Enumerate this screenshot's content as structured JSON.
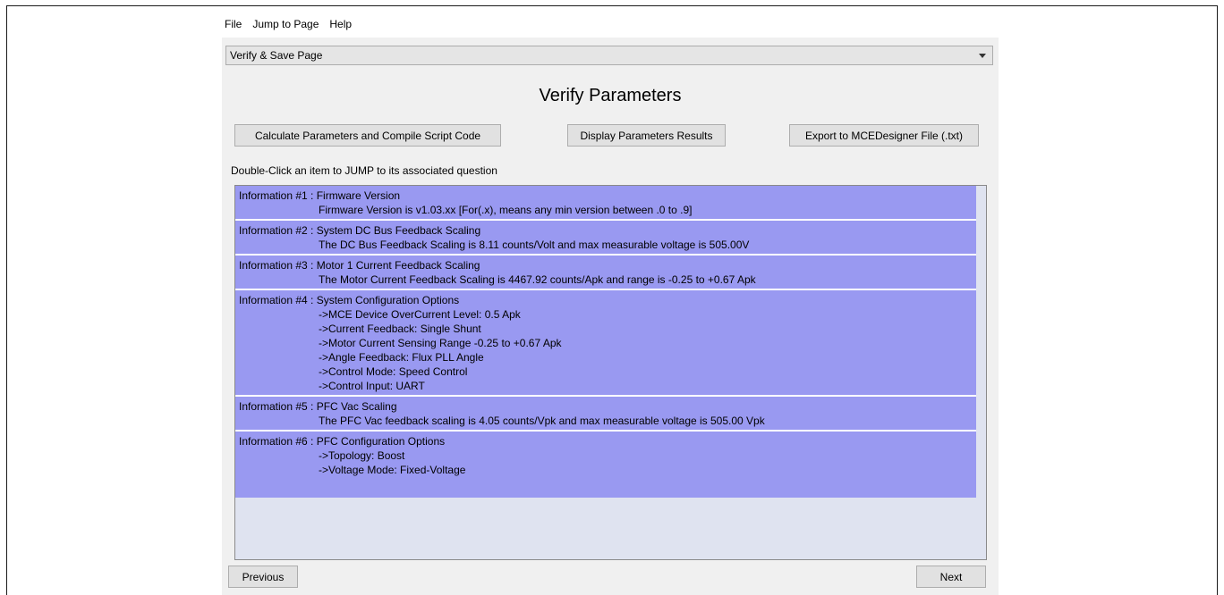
{
  "menu": {
    "items": [
      "File",
      "Jump to Page",
      "Help"
    ]
  },
  "page_select": {
    "value": "Verify & Save Page"
  },
  "title": "Verify Parameters",
  "buttons": {
    "calculate": "Calculate Parameters and Compile Script Code",
    "display": "Display Parameters Results",
    "export": "Export to MCEDesigner File (.txt)",
    "previous": "Previous",
    "next": "Next"
  },
  "hint": "Double-Click an item to JUMP to its associated question",
  "items": [
    {
      "header": "Information #1 : Firmware Version",
      "lines": [
        "Firmware Version is v1.03.xx [For(.x), means any min version between .0 to .9]"
      ]
    },
    {
      "header": "Information #2 : System DC Bus Feedback Scaling",
      "lines": [
        "The DC Bus Feedback Scaling is 8.11 counts/Volt and max measurable voltage is 505.00V"
      ]
    },
    {
      "header": "Information #3 : Motor 1 Current Feedback Scaling",
      "lines": [
        "The Motor Current Feedback Scaling is 4467.92 counts/Apk and range is -0.25 to +0.67 Apk"
      ]
    },
    {
      "header": "Information #4 : System Configuration Options",
      "lines": [
        "->MCE Device OverCurrent Level:  0.5 Apk",
        "->Current Feedback:  Single Shunt",
        "->Motor Current Sensing Range  -0.25 to +0.67 Apk",
        "->Angle Feedback: Flux PLL Angle",
        "->Control Mode: Speed Control",
        "->Control Input: UART"
      ]
    },
    {
      "header": "Information #5 : PFC Vac Scaling",
      "lines": [
        "The PFC Vac feedback scaling is 4.05 counts/Vpk and max measurable voltage is 505.00 Vpk"
      ]
    },
    {
      "header": "Information #6 : PFC Configuration Options",
      "lines": [
        "->Topology:  Boost",
        "->Voltage Mode: Fixed-Voltage"
      ]
    }
  ]
}
